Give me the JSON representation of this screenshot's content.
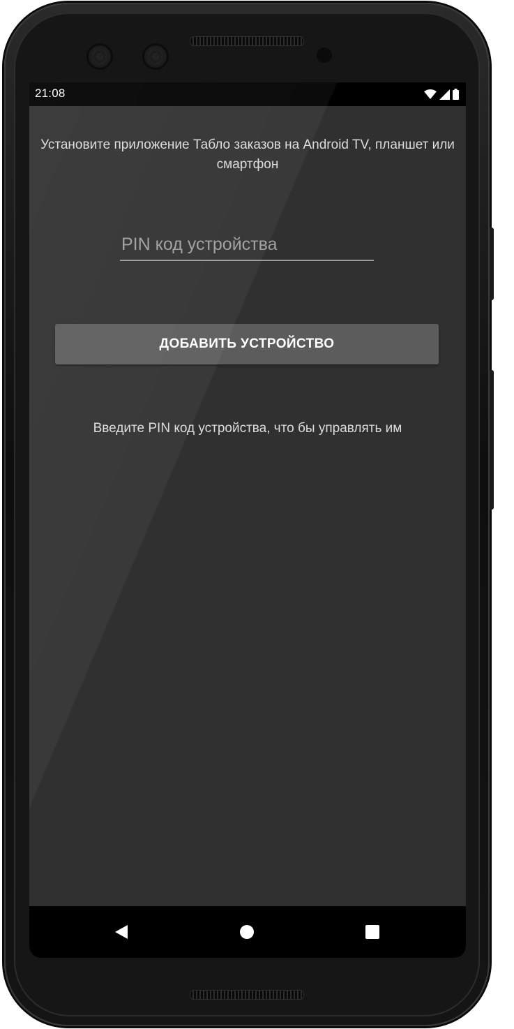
{
  "status_bar": {
    "time": "21:08",
    "icons": [
      "wifi-icon",
      "signal-icon",
      "battery-icon"
    ]
  },
  "screen": {
    "instruction": "Установите приложение Табло заказов на Android TV, планшет или смартфон",
    "pin_input": {
      "placeholder": "PIN код устройства",
      "value": ""
    },
    "add_button_label": "ДОБАВИТЬ УСТРОЙСТВО",
    "hint": "Введите PIN код устройства, что бы управлять им"
  },
  "nav_bar": {
    "buttons": [
      "back-icon",
      "home-icon",
      "recents-icon"
    ]
  },
  "colors": {
    "screen_background": "#303030",
    "button_background": "#5c5c5c",
    "text": "#dcdcdc",
    "bars": "#000000"
  }
}
